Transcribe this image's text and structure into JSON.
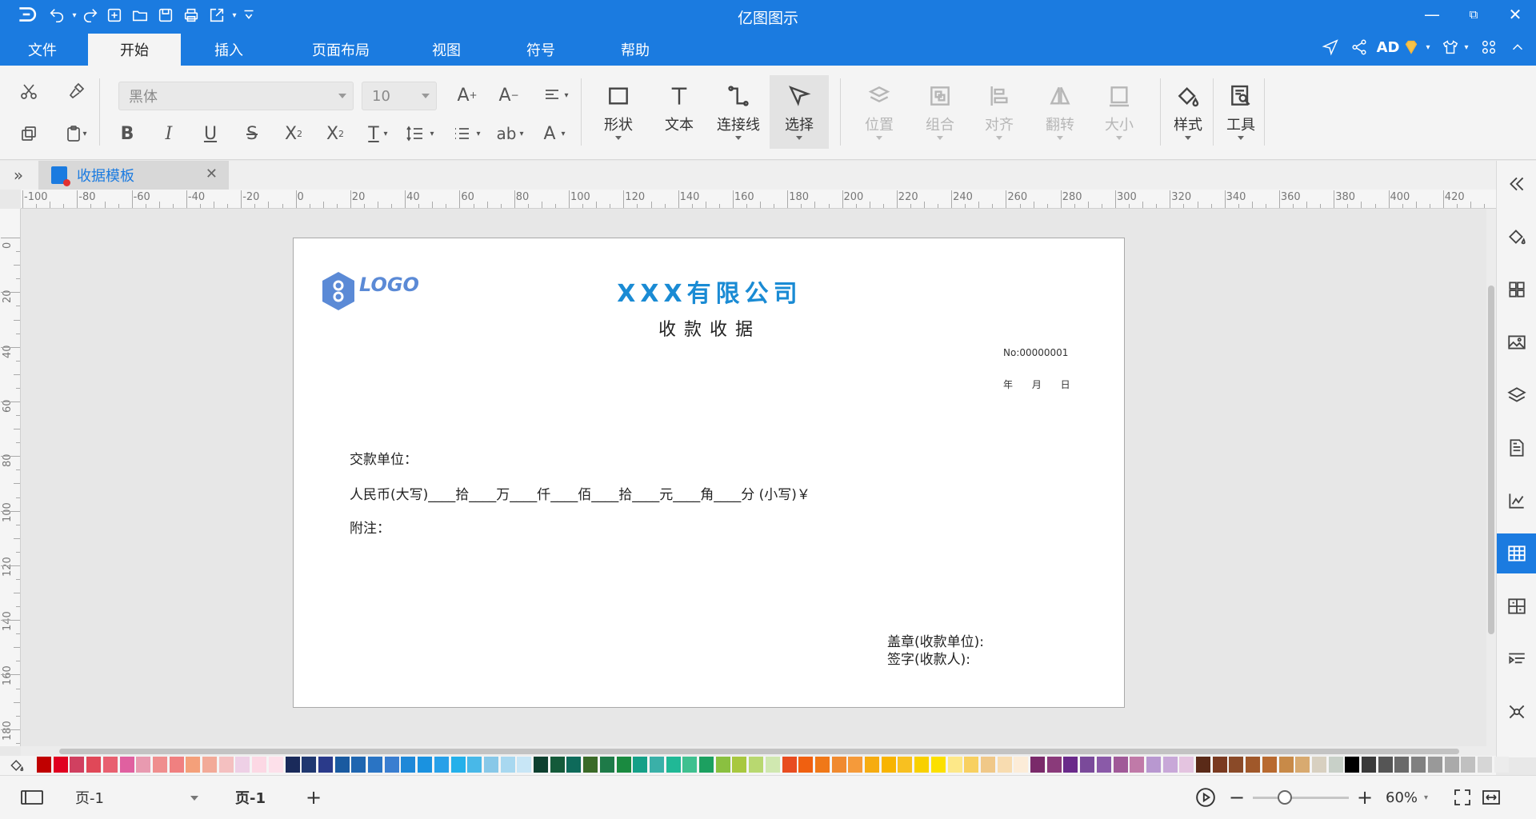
{
  "app": {
    "title": "亿图图示"
  },
  "menu": {
    "tabs": [
      {
        "label": "文件"
      },
      {
        "label": "开始"
      },
      {
        "label": "插入"
      },
      {
        "label": "页面布局"
      },
      {
        "label": "视图"
      },
      {
        "label": "符号"
      },
      {
        "label": "帮助"
      }
    ],
    "active_tab": "开始",
    "user": "AD"
  },
  "ribbon": {
    "font_family": "黑体",
    "font_size": "10",
    "tools": {
      "shape": "形状",
      "text": "文本",
      "connector": "连接线",
      "select": "选择",
      "position": "位置",
      "group": "组合",
      "align": "对齐",
      "flip": "翻转",
      "size": "大小",
      "style": "样式",
      "utilities": "工具"
    }
  },
  "document": {
    "tab_label": "收据模板"
  },
  "ruler": {
    "h_labels": [
      "-100",
      "-80",
      "-60",
      "-40",
      "-20",
      "0",
      "20",
      "40",
      "60",
      "80",
      "100",
      "120",
      "140",
      "160",
      "180",
      "200",
      "220",
      "240",
      "260",
      "280",
      "300",
      "320",
      "340",
      "360",
      "380",
      "400",
      "420"
    ],
    "v_labels": [
      "0",
      "20",
      "40",
      "60",
      "80",
      "100",
      "120",
      "140",
      "160",
      "180"
    ]
  },
  "receipt": {
    "logo_text": "LOGO",
    "company": "XXX有限公司",
    "title": "收款收据",
    "number": "No:00000001",
    "date_line": "年 月 日",
    "payer": "交款单位：",
    "amount": "人民币(大写)____拾____万____仟____佰____拾____元____角____分 (小写)￥",
    "remark": "附注：",
    "seal": "盖章(收款单位):",
    "signature": "签字(收款人):"
  },
  "palette": {
    "colors": [
      "#c00000",
      "#e00020",
      "#d04060",
      "#e04858",
      "#e86070",
      "#e060a0",
      "#e89ab0",
      "#ef8e8e",
      "#f08080",
      "#f4a07a",
      "#f2aa98",
      "#f4c0c0",
      "#eed0e6",
      "#fcd8e4",
      "#fde0ea",
      "#1a2a5a",
      "#203870",
      "#2a3a8a",
      "#1a5aa0",
      "#1f66b0",
      "#2a74c4",
      "#3a7ed0",
      "#1e88d8",
      "#1a92e0",
      "#28a0e8",
      "#24b0ea",
      "#48b8e8",
      "#88c8e8",
      "#a8d8f0",
      "#c8e6f6",
      "#0e4030",
      "#145a3a",
      "#0e6a5a",
      "#3a6a28",
      "#1e7a48",
      "#1a8a40",
      "#16a088",
      "#3ab0a8",
      "#20b896",
      "#40c090",
      "#1ca060",
      "#8ac040",
      "#a8c840",
      "#b8d870",
      "#d0e8b0",
      "#e84c20",
      "#f06010",
      "#f07818",
      "#f08a30",
      "#f59a3a",
      "#f6ac10",
      "#f8b400",
      "#f8c020",
      "#f8d000",
      "#fce000",
      "#fde888",
      "#f8d060",
      "#f0c888",
      "#f8dcb0",
      "#fcecd8",
      "#7a2a6a",
      "#8a3a7a",
      "#6a2a8a",
      "#7a4a9a",
      "#8a5aa8",
      "#a05a98",
      "#c07aa8",
      "#b898d0",
      "#c8a8d8",
      "#e4c4e0",
      "#5a2a18",
      "#7a3a20",
      "#8a4a28",
      "#a0582a",
      "#b86a30",
      "#c88a48",
      "#d8aa70",
      "#d8d0c0",
      "#c8d0c8",
      "#000000",
      "#3a3a3a",
      "#555555",
      "#6a6a6a",
      "#808080",
      "#999999",
      "#aaaaaa",
      "#c0c0c0",
      "#d6d6d6",
      "#ececec"
    ]
  },
  "status": {
    "page_select": "页-1",
    "page_tab": "页-1",
    "zoom": "60%",
    "zoom_level": 0.3
  }
}
